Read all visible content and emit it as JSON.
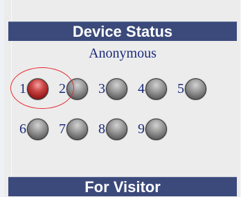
{
  "device_status_panel": {
    "header_title": "Device Status",
    "user_label": "Anonymous",
    "devices": [
      {
        "number": "1",
        "state": "active",
        "color": "#b22222"
      },
      {
        "number": "2",
        "state": "inactive",
        "color": "#808080"
      },
      {
        "number": "3",
        "state": "inactive",
        "color": "#808080"
      },
      {
        "number": "4",
        "state": "inactive",
        "color": "#808080"
      },
      {
        "number": "5",
        "state": "inactive",
        "color": "#808080"
      },
      {
        "number": "6",
        "state": "inactive",
        "color": "#808080"
      },
      {
        "number": "7",
        "state": "inactive",
        "color": "#808080"
      },
      {
        "number": "8",
        "state": "inactive",
        "color": "#808080"
      },
      {
        "number": "9",
        "state": "inactive",
        "color": "#808080"
      }
    ]
  },
  "visitor_panel": {
    "header_title": "For Visitor"
  },
  "colors": {
    "header_background": "#3b4a7a",
    "panel_background": "#ececec",
    "label_text": "#1b2b7b",
    "highlight_ring": "#e8282f"
  }
}
